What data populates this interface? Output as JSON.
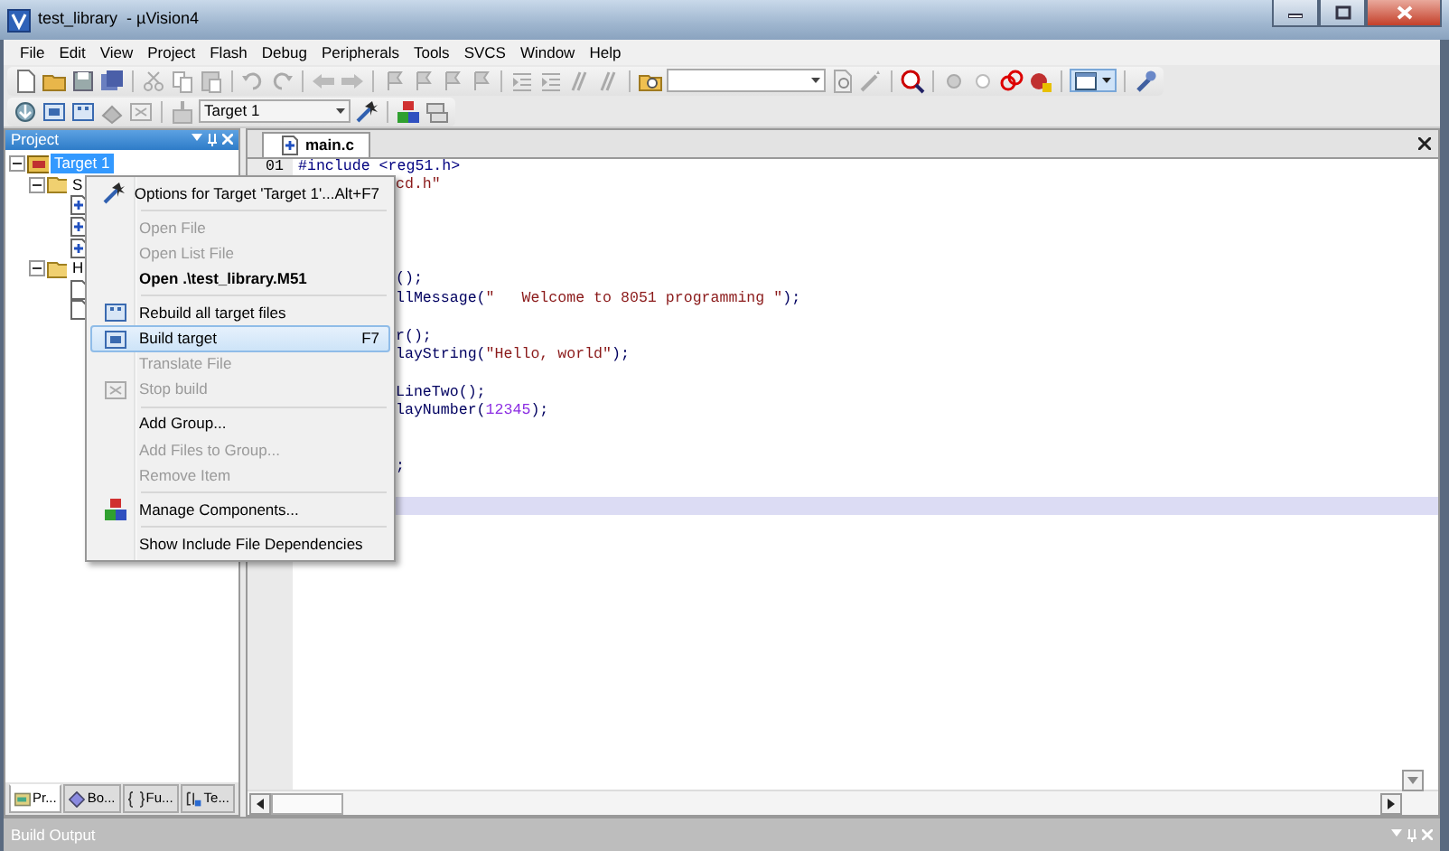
{
  "window": {
    "title": "test_library  - µVision4"
  },
  "menu_bar": [
    "File",
    "Edit",
    "View",
    "Project",
    "Flash",
    "Debug",
    "Peripherals",
    "Tools",
    "SVCS",
    "Window",
    "Help"
  ],
  "build_toolbar": {
    "target": "Target 1"
  },
  "project_panel": {
    "title": "Project",
    "tree": [
      {
        "label": "Target 1",
        "kind": "target",
        "selected": true,
        "expanded": true,
        "children": [
          {
            "label": "S",
            "kind": "group",
            "selected": false,
            "expanded": true,
            "children": [
              {
                "kind": "source-file"
              },
              {
                "kind": "source-file"
              },
              {
                "kind": "source-file"
              }
            ]
          },
          {
            "label": "H",
            "kind": "group",
            "selected": false,
            "expanded": true,
            "children": [
              {
                "kind": "header-file"
              },
              {
                "kind": "header-file"
              }
            ]
          }
        ]
      }
    ],
    "tabs": [
      {
        "label": "Pr...",
        "selected": true
      },
      {
        "label": "Bo...",
        "selected": false
      },
      {
        "label": "Fu...",
        "selected": false
      },
      {
        "label": "Te...",
        "selected": false
      }
    ]
  },
  "editor": {
    "tab": "main.c",
    "lines": [
      {
        "number": "01",
        "behind_menu": false,
        "current": false,
        "tokens": [
          {
            "kind": "preproc",
            "text": "#include <reg51.h>"
          }
        ]
      },
      {
        "behind_menu": true,
        "current": false,
        "tokens": [
          {
            "kind": "string",
            "text": "cd.h\""
          }
        ]
      },
      {
        "current": false
      },
      {
        "current": false
      },
      {
        "current": false
      },
      {
        "current": false
      },
      {
        "behind_menu": true,
        "current": false,
        "tokens": [
          {
            "kind": "plain",
            "text": "();"
          }
        ]
      },
      {
        "behind_menu": true,
        "current": false,
        "tokens": [
          {
            "kind": "plain",
            "text": "llMessage("
          },
          {
            "kind": "string",
            "text": "\"   Welcome to 8051 programming \""
          },
          {
            "kind": "plain",
            "text": ");"
          }
        ]
      },
      {
        "current": false
      },
      {
        "behind_menu": true,
        "current": false,
        "tokens": [
          {
            "kind": "plain",
            "text": "r();"
          }
        ]
      },
      {
        "behind_menu": true,
        "current": false,
        "tokens": [
          {
            "kind": "plain",
            "text": "layString("
          },
          {
            "kind": "string",
            "text": "\"Hello, world\""
          },
          {
            "kind": "plain",
            "text": ");"
          }
        ]
      },
      {
        "current": false
      },
      {
        "behind_menu": true,
        "current": false,
        "tokens": [
          {
            "kind": "plain",
            "text": "LineTwo();"
          }
        ]
      },
      {
        "behind_menu": true,
        "current": false,
        "tokens": [
          {
            "kind": "plain",
            "text": "layNumber("
          },
          {
            "kind": "number",
            "text": "12345"
          },
          {
            "kind": "plain",
            "text": ");"
          }
        ]
      },
      {
        "current": false
      },
      {
        "current": false
      },
      {
        "behind_menu": true,
        "current": false,
        "tokens": [
          {
            "kind": "plain",
            "text": ";"
          }
        ]
      },
      {
        "current": false
      },
      {
        "current": true
      }
    ]
  },
  "context_menu": {
    "items": [
      {
        "label": "Options for Target 'Target 1'...",
        "shortcut": "Alt+F7",
        "disabled": false,
        "bold": false,
        "selected": false
      },
      {
        "label": "Open File",
        "disabled": true,
        "bold": false,
        "selected": false,
        "separator_before": true
      },
      {
        "label": "Open List File",
        "disabled": true,
        "bold": false,
        "selected": false
      },
      {
        "label": "Open .\\test_library.M51",
        "disabled": false,
        "bold": true,
        "selected": false
      },
      {
        "label": "Rebuild all target files",
        "disabled": false,
        "bold": false,
        "selected": false,
        "separator_before": true
      },
      {
        "label": "Build target",
        "shortcut": "F7",
        "disabled": false,
        "bold": false,
        "selected": true
      },
      {
        "label": "Translate File",
        "disabled": true,
        "bold": false,
        "selected": false
      },
      {
        "label": "Stop build",
        "disabled": true,
        "bold": false,
        "selected": false
      },
      {
        "label": "Add Group...",
        "disabled": false,
        "bold": false,
        "selected": false,
        "separator_before": true
      },
      {
        "label": "Add Files to Group...",
        "disabled": true,
        "bold": false,
        "selected": false
      },
      {
        "label": "Remove Item",
        "disabled": true,
        "bold": false,
        "selected": false
      },
      {
        "label": "Manage Components...",
        "disabled": false,
        "bold": false,
        "selected": false,
        "separator_before": true
      },
      {
        "label": "Show Include File Dependencies",
        "disabled": false,
        "bold": false,
        "selected": false,
        "separator_before": true
      }
    ]
  },
  "build_output": {
    "title": "Build Output"
  }
}
